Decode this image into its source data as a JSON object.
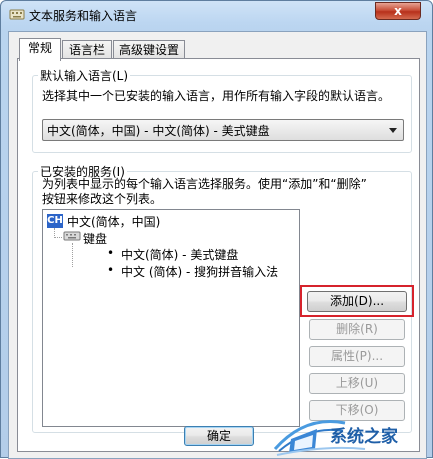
{
  "window": {
    "title": "文本服务和输入语言",
    "close_label": "x"
  },
  "tabs": [
    {
      "label": "常规",
      "active": true
    },
    {
      "label": "语言栏",
      "active": false
    },
    {
      "label": "高级键设置",
      "active": false
    }
  ],
  "default_language": {
    "group_title": "默认输入语言(L)",
    "description": "选择其中一个已安装的输入语言，用作所有输入字段的默认语言。",
    "selected": "中文(简体，中国) - 中文(简体) - 美式键盘"
  },
  "installed_services": {
    "group_title": "已安装的服务(I)",
    "description_line1": "为列表中显示的每个输入语言选择服务。使用“添加”和“删除”",
    "description_line2": "按钮来修改这个列表。",
    "tree": {
      "language_badge": "CH",
      "language": "中文(简体，中国)",
      "category": "键盘",
      "items": [
        "中文(简体) - 美式键盘",
        "中文 (简体) - 搜狗拼音输入法"
      ]
    },
    "buttons": {
      "add": "添加(D)...",
      "remove": "删除(R)",
      "properties": "属性(P)...",
      "move_up": "上移(U)",
      "move_down": "下移(O)"
    }
  },
  "footer": {
    "ok": "确定"
  },
  "watermark": {
    "text": "系统之家"
  },
  "colors": {
    "highlight_border": "#d6232c",
    "selection_badge": "#2c64c8",
    "close_button": "#c9503a"
  }
}
